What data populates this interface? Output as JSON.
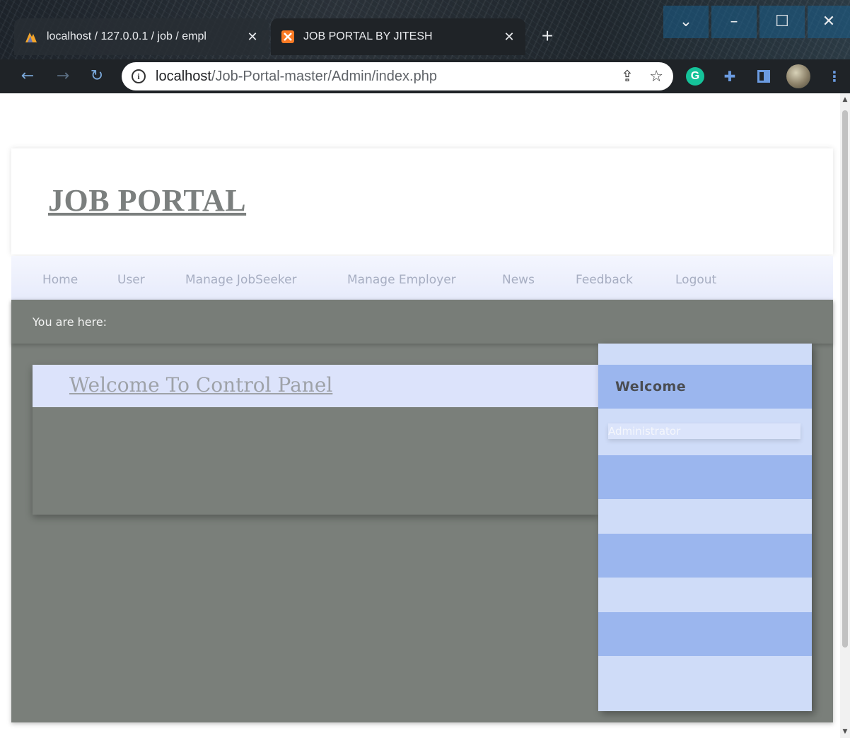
{
  "browser": {
    "tabs": [
      {
        "title": "localhost / 127.0.0.1 / job / empl",
        "active": false
      },
      {
        "title": "JOB PORTAL BY JITESH",
        "active": true
      }
    ],
    "url_host": "localhost",
    "url_path": "/Job-Portal-master/Admin/index.php",
    "extension_letter": "G"
  },
  "site": {
    "logo": "JOB PORTAL",
    "menu": [
      "Home",
      "User",
      "Manage JobSeeker",
      "Manage Employer",
      "News",
      "Feedback",
      "Logout"
    ],
    "breadcrumb_label": "You are here:",
    "panel_title": "Welcome To Control Panel",
    "sidebar": {
      "welcome": "Welcome",
      "user": "Administrator"
    }
  },
  "colors": {
    "content_bg": "#7a7f7a",
    "menu_text": "#a7aec2",
    "sidebar_stripe": "#9bb6ee",
    "sidebar_light": "#cfdcf8"
  }
}
